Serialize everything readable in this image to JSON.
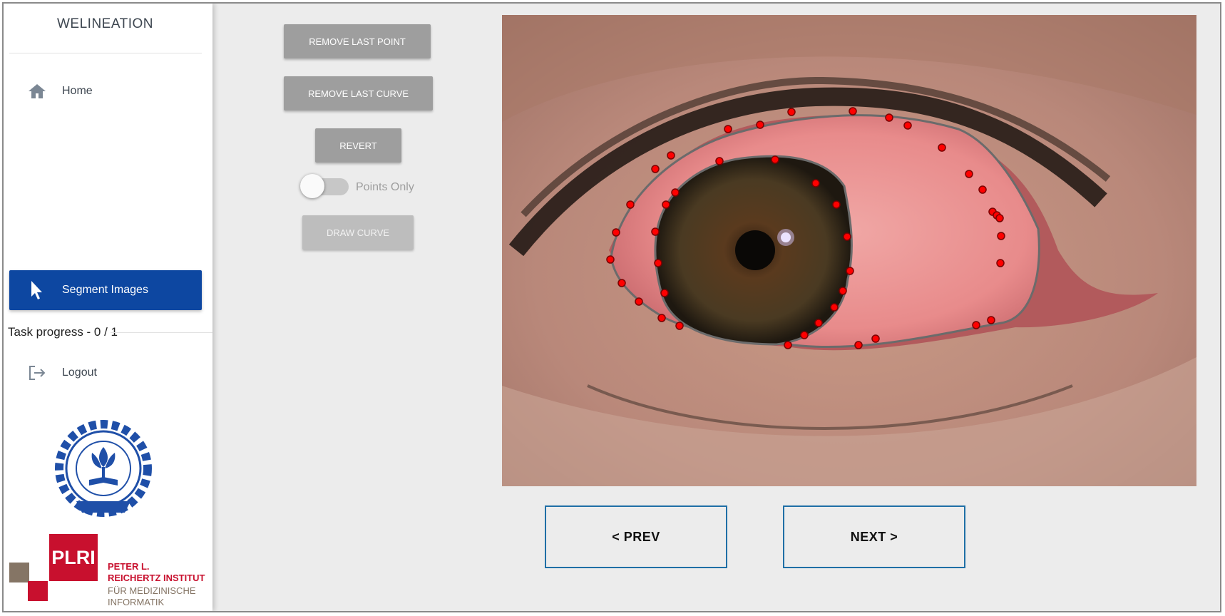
{
  "sidebar": {
    "brand": "WELINEATION",
    "items": [
      {
        "label": "Home",
        "icon": "home-icon"
      },
      {
        "label": "Segment Images",
        "icon": "cursor-arrow-icon"
      },
      {
        "label": "Logout",
        "icon": "logout-icon"
      }
    ],
    "task_progress": "Task progress - 0 / 1",
    "logos": {
      "iit": "IIT Bombay emblem",
      "plri_mark": "PLRI",
      "plri_name": [
        "PETER L.",
        "REICHERTZ INSTITUT"
      ],
      "plri_sub": [
        "FÜR MEDIZINISCHE",
        "INFORMATIK"
      ]
    }
  },
  "tools": {
    "remove_last_point": "REMOVE LAST POINT",
    "remove_last_curve": "REMOVE LAST CURVE",
    "revert": "REVERT",
    "points_only": "Points Only",
    "points_only_enabled": false,
    "draw_curve": "DRAW CURVE"
  },
  "navigation": {
    "prev": "< PREV",
    "next": "NEXT >"
  },
  "colors": {
    "accent": "#0d47a1",
    "tool_button": "#9e9e9e",
    "point_marker": "#ff0000",
    "nav_border": "#1f6fa6",
    "plri_red": "#c8102e"
  }
}
